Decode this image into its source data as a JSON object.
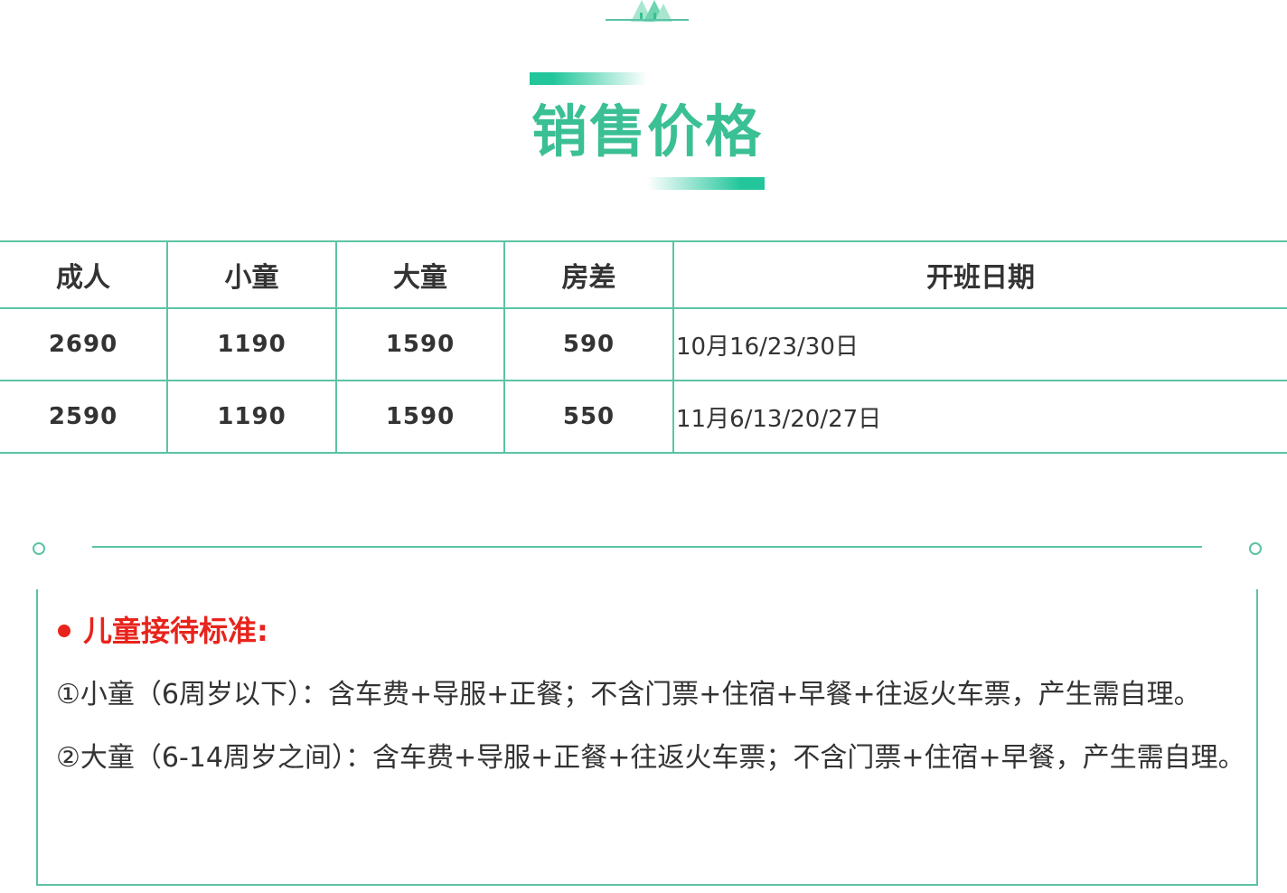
{
  "section": {
    "title": "销售价格"
  },
  "price_table": {
    "headers": [
      "成人",
      "小童",
      "大童",
      "房差",
      "开班日期"
    ],
    "rows": [
      [
        "2690",
        "1190",
        "1590",
        "590",
        "10月16/23/30日"
      ],
      [
        "2590",
        "1190",
        "1590",
        "550",
        "11月6/13/20/27日"
      ]
    ]
  },
  "children_policy": {
    "heading": "儿童接待标准:",
    "lines": [
      "①小童（6周岁以下）：含车费+导服+正餐；不含门票+住宿+早餐+往返火车票，产生需自理。",
      "②大童（6-14周岁之间）：含车费+导服+正餐+往返火车票；不含门票+住宿+早餐，产生需自理。"
    ]
  },
  "colors": {
    "accent": "#3bbf94",
    "border": "#5cc3a5",
    "heading_red": "#e8241c",
    "text": "#333333"
  }
}
